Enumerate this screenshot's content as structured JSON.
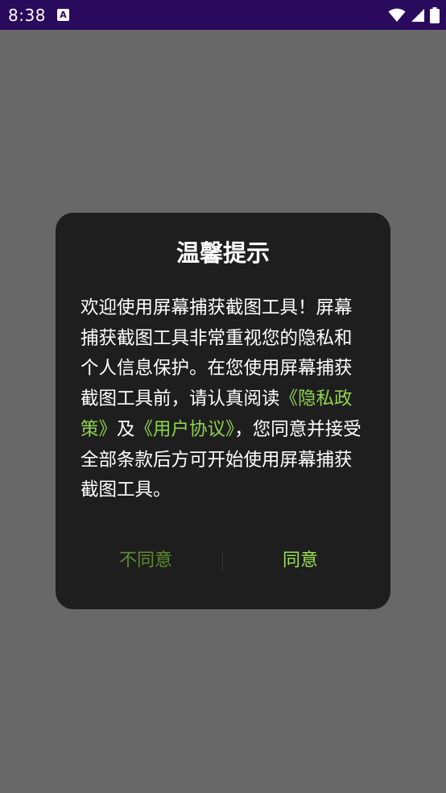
{
  "status_bar": {
    "time": "8:38",
    "notification_icon": "a-icon",
    "wifi_icon": "wifi-icon",
    "signal_icon": "signal-icon",
    "battery_icon": "battery-icon"
  },
  "dialog": {
    "title": "温馨提示",
    "body": {
      "part1": "欢迎使用屏幕捕获截图工具！屏幕捕获截图工具非常重视您的隐私和个人信息保护。在您使用屏幕捕获截图工具前，请认真阅读",
      "privacy_link": "《隐私政策》",
      "connector": "及",
      "agreement_link": "《用户协议》",
      "part2": "，您同意并接受全部条款后方可开始使用屏幕捕获截图工具。"
    },
    "buttons": {
      "disagree": "不同意",
      "agree": "同意"
    }
  },
  "colors": {
    "status_bar_bg": "#2a0a5c",
    "scrim": "#686868",
    "dialog_bg": "#1e1e1e",
    "link": "#8fd24c",
    "agree": "#9be057",
    "disagree": "#5f8a31"
  }
}
